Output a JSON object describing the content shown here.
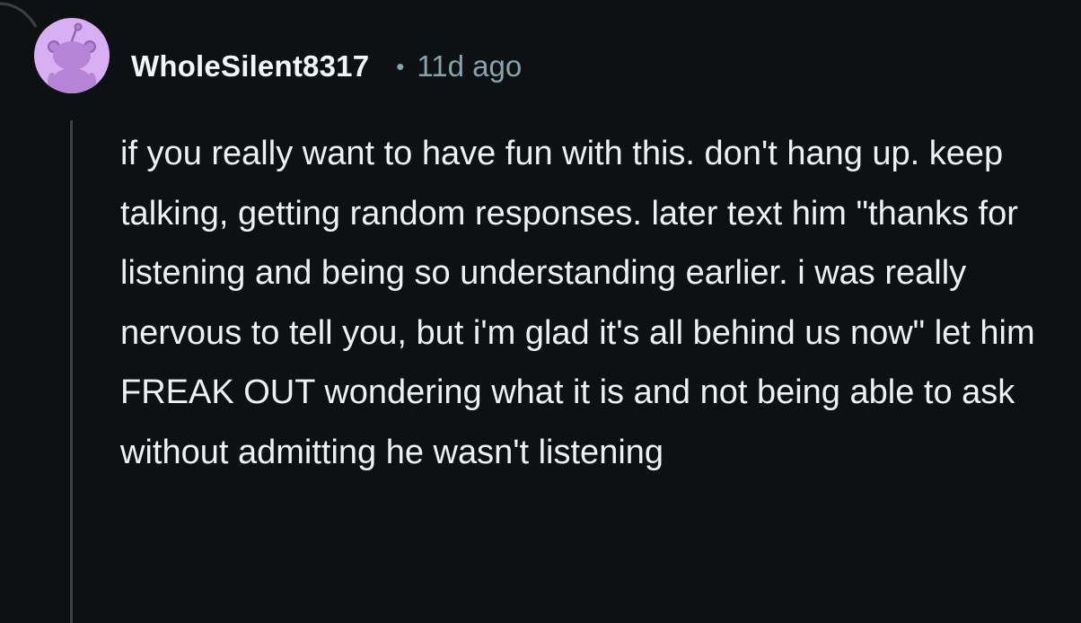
{
  "comment": {
    "username": "WholeSilent8317",
    "separator": "•",
    "timestamp": "11d ago",
    "body": "if you really want to have fun with this. don't hang up. keep talking, getting random responses. later text him \"thanks for listening and being so understanding earlier. i was really nervous to tell you, but i'm glad it's all behind us now\" let him FREAK OUT wondering what it is and not being able to ask without admitting he wasn't listening",
    "avatar": {
      "icon": "snoo-avatar-icon",
      "background_color": "#d7aff2",
      "figure_color": "#b584d6"
    }
  },
  "colors": {
    "background": "#0e1113",
    "text_primary": "#eef1f3",
    "text_secondary": "#8ba2ad",
    "thread_line": "#3b4145"
  }
}
